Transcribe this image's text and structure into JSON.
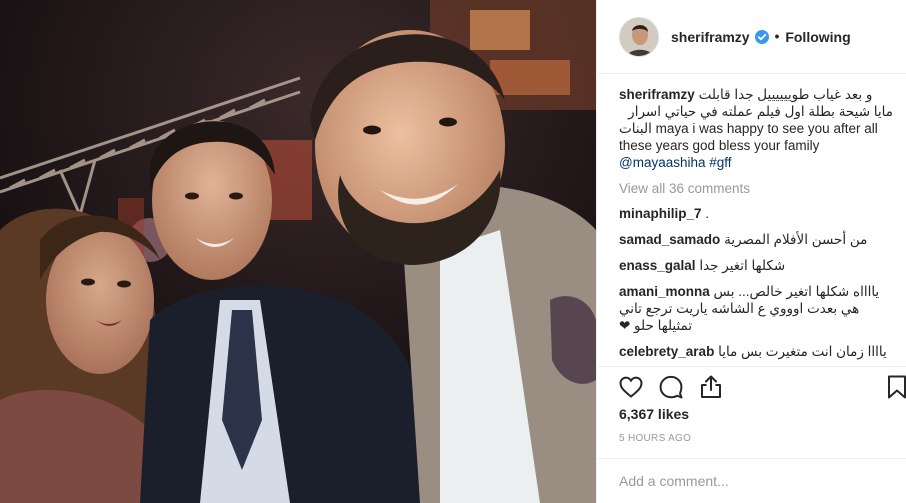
{
  "post": {
    "username": "sheriframzy",
    "follow_label": "Following",
    "separator": "•",
    "verified_icon": "verified-badge-icon",
    "caption": {
      "username": "sheriframzy",
      "line1": "و بعد غياب طوييييييل جدا قابلت",
      "line2": "مايا شيحة بطلة اول فيلم عملته في حياتي اسرار",
      "line3": "البنات maya i was happy to see you after all",
      "line4": "these years god bless your family",
      "mention": "@mayaashiha",
      "hashtag": "#gff"
    },
    "view_all": "View all 36 comments",
    "comments": [
      {
        "user": "minaphilip_7",
        "text": "."
      },
      {
        "user": "samad_samado",
        "text": "من أحسن الأفلام المصرية"
      },
      {
        "user": "enass_galal",
        "text": "شكلها اتغير جدا"
      },
      {
        "user": "amani_monna",
        "text": "يااااه شكلها اتغير خالص... بس",
        "text2": "هي بعدت اوووي ع الشاشه ياريت ترجع تاني",
        "text3": "تمثيلها حلو ❤"
      },
      {
        "user": "celebrety_arab",
        "text": "ياااا زمان انت متغيرت بس مايا"
      }
    ],
    "likes": "6,367 likes",
    "timestamp": "5 HOURS AGO",
    "add_comment_placeholder": "Add a comment...",
    "icons": [
      "heart-icon",
      "comment-icon",
      "share-icon",
      "bookmark-icon"
    ],
    "colors": {
      "accent_link": "#003569",
      "muted": "#999999",
      "verified": "#3897f0",
      "border": "#efefef"
    }
  }
}
